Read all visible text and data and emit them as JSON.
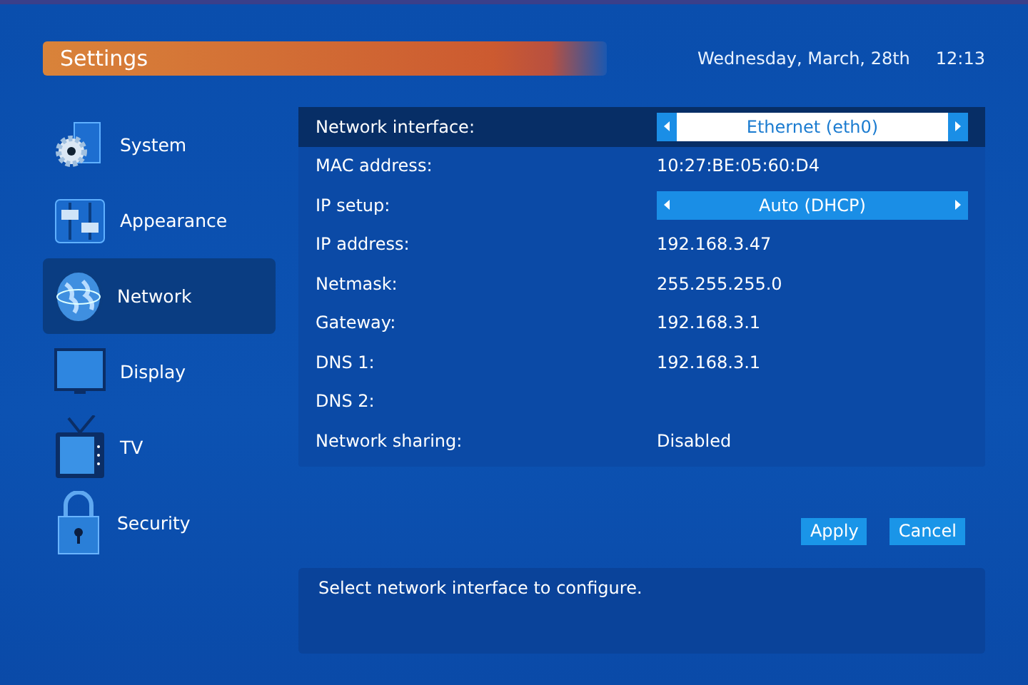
{
  "header": {
    "title": "Settings",
    "date": "Wednesday, March, 28th",
    "time": "12:13"
  },
  "sidebar": {
    "items": [
      {
        "label": "System",
        "kind": "system",
        "selected": false
      },
      {
        "label": "Appearance",
        "kind": "appearance",
        "selected": false
      },
      {
        "label": "Network",
        "kind": "network",
        "selected": true
      },
      {
        "label": "Display",
        "kind": "display",
        "selected": false
      },
      {
        "label": "TV",
        "kind": "tv",
        "selected": false
      },
      {
        "label": "Security",
        "kind": "security",
        "selected": false
      }
    ]
  },
  "settings": {
    "rows": [
      {
        "label": "Network interface:",
        "kind": "selector",
        "value": "Ethernet (eth0)",
        "selected": true
      },
      {
        "label": "MAC address:",
        "kind": "text",
        "value": "10:27:BE:05:60:D4",
        "selected": false
      },
      {
        "label": "IP setup:",
        "kind": "selector",
        "value": "Auto (DHCP)",
        "selected": false
      },
      {
        "label": "IP address:",
        "kind": "text",
        "value": "192.168.3.47",
        "selected": false
      },
      {
        "label": "Netmask:",
        "kind": "text",
        "value": "255.255.255.0",
        "selected": false
      },
      {
        "label": "Gateway:",
        "kind": "text",
        "value": "192.168.3.1",
        "selected": false
      },
      {
        "label": "DNS 1:",
        "kind": "text",
        "value": "192.168.3.1",
        "selected": false
      },
      {
        "label": "DNS 2:",
        "kind": "text",
        "selected": false
      },
      {
        "label": "Network sharing:",
        "kind": "text",
        "value": "Disabled",
        "selected": false
      }
    ]
  },
  "buttons": [
    "Apply",
    "Cancel"
  ],
  "help": "Select network interface to configure."
}
